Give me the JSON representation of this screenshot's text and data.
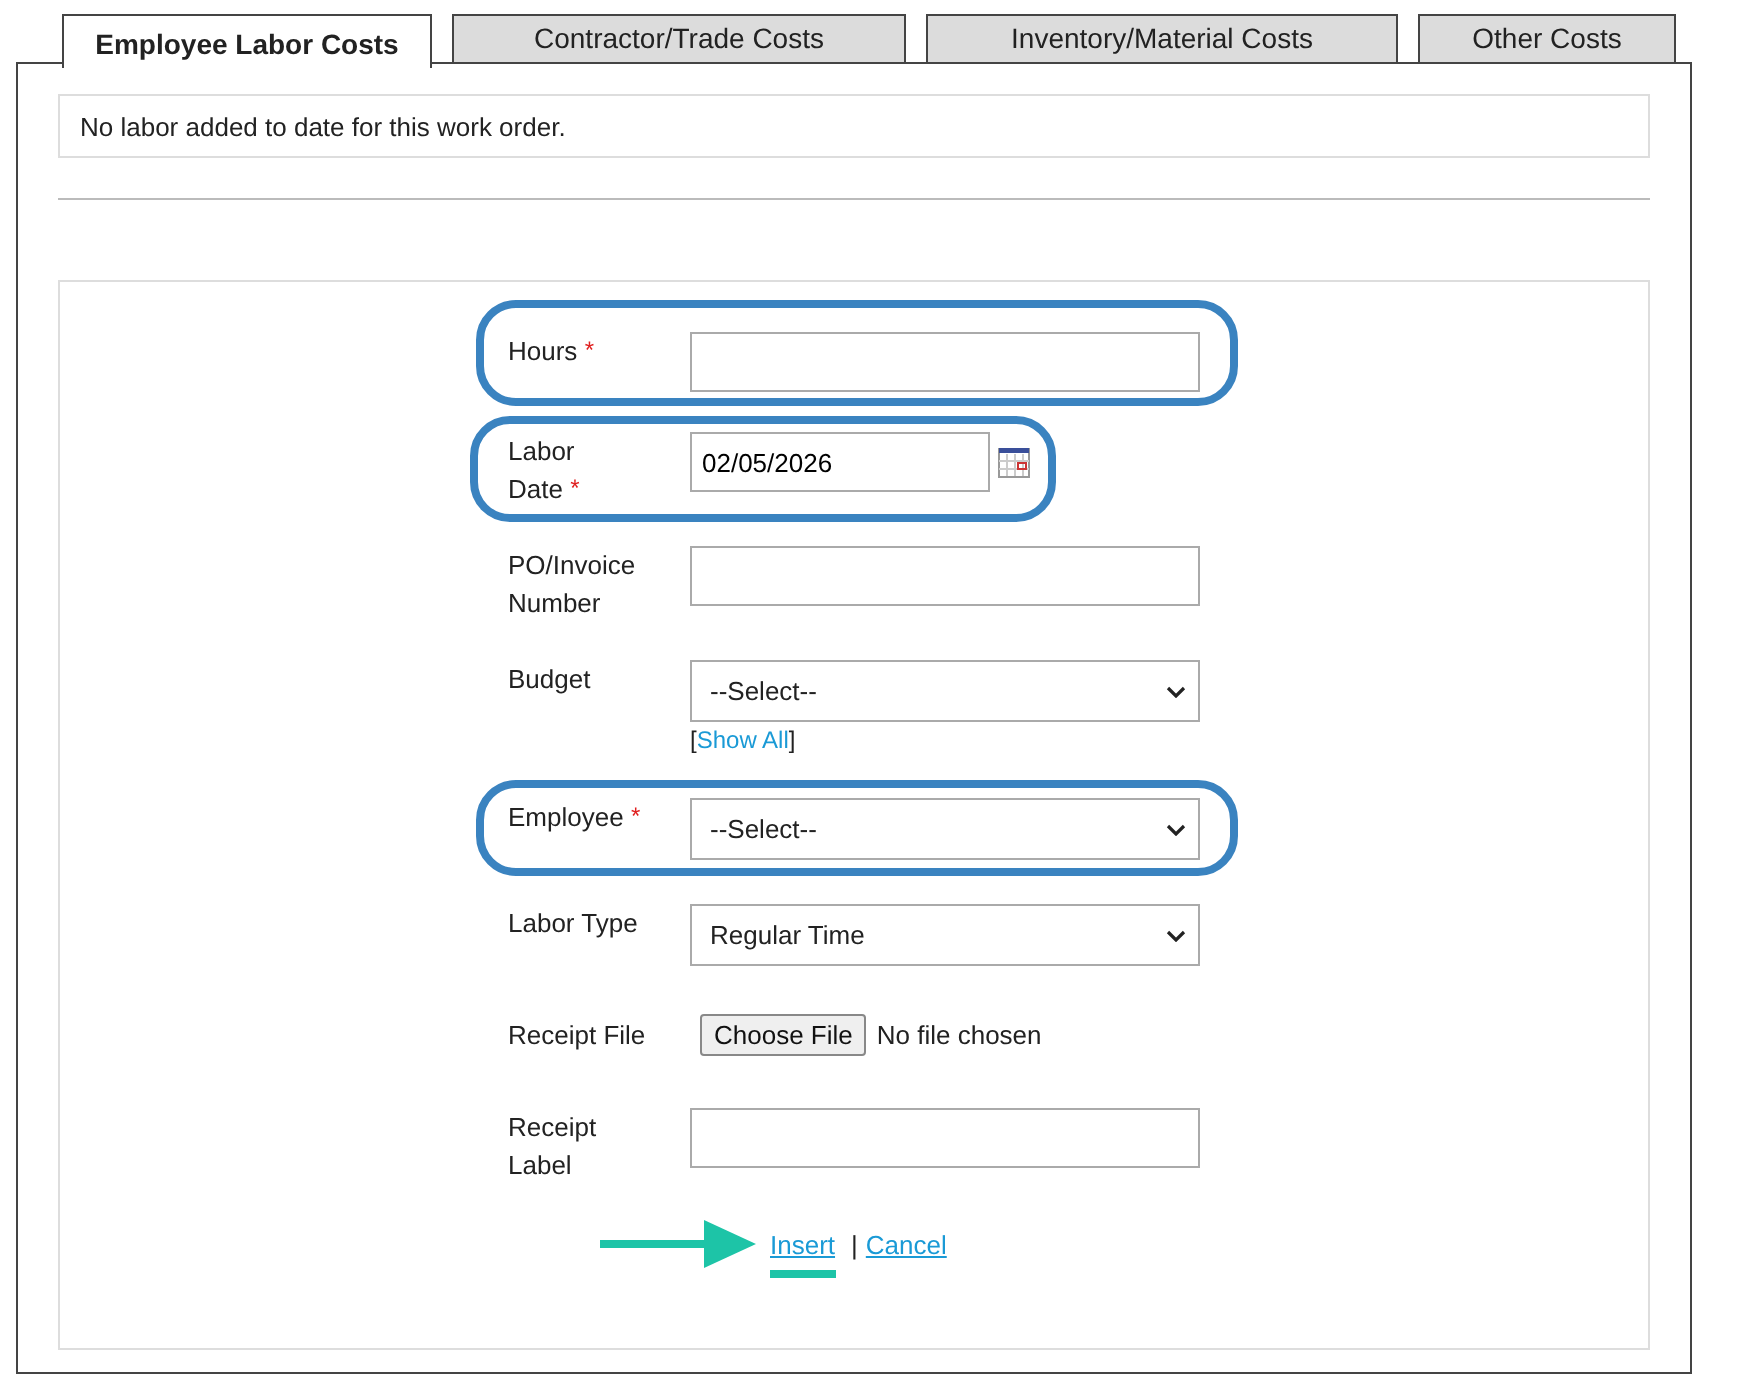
{
  "tabs": [
    {
      "label": "Employee Labor Costs",
      "selected": true
    },
    {
      "label": "Contractor/Trade Costs",
      "selected": false
    },
    {
      "label": "Inventory/Material Costs",
      "selected": false
    },
    {
      "label": "Other Costs",
      "selected": false
    }
  ],
  "message": "No labor added to date for this work order.",
  "form": {
    "fields": [
      {
        "kind": "text",
        "label": "Hours",
        "required_mark": "*",
        "highlighted": true
      },
      {
        "kind": "date",
        "label": "Labor Date",
        "required_mark": "*",
        "value": "02/05/2026",
        "highlighted": true
      },
      {
        "kind": "text",
        "label": "PO/Invoice Number",
        "highlighted": false
      },
      {
        "kind": "select",
        "label": "Budget",
        "value": "--Select--",
        "link": {
          "before": "[",
          "label": "Show All",
          "after": "]"
        },
        "highlighted": false
      },
      {
        "kind": "select",
        "label": "Employee",
        "required_mark": "*",
        "value": "--Select--",
        "highlighted": true
      },
      {
        "kind": "select",
        "label": "Labor Type",
        "value": "Regular Time",
        "highlighted": false
      },
      {
        "kind": "file",
        "label": "Receipt File",
        "button": "Choose File",
        "status": "No file chosen",
        "highlighted": false
      },
      {
        "kind": "text",
        "label": "Receipt Label",
        "highlighted": false
      }
    ],
    "actions": [
      {
        "label": "Insert",
        "pointed": true
      },
      {
        "label": "Cancel",
        "pointed": false
      }
    ],
    "separator": "|"
  }
}
